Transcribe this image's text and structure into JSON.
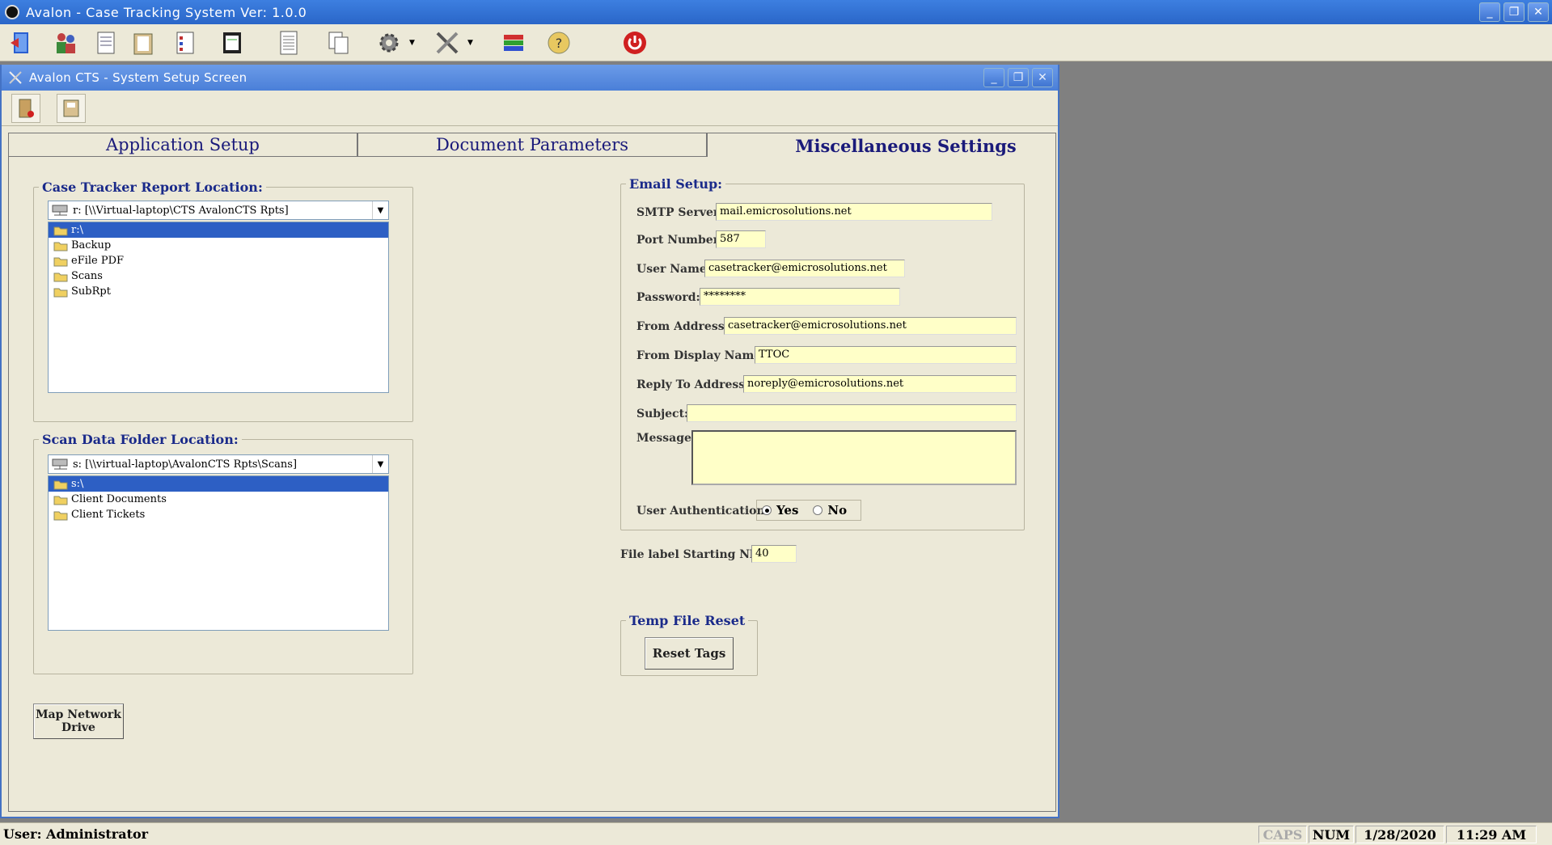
{
  "app": {
    "title": "Avalon - Case Tracking System   Ver: 1.0.0"
  },
  "window_buttons": {
    "minimize": "_",
    "restore": "❐",
    "close": "✕"
  },
  "child": {
    "title": "Avalon CTS - System Setup Screen"
  },
  "tabs": [
    {
      "label": "Application Setup"
    },
    {
      "label": "Document Parameters"
    },
    {
      "label": "Miscellaneous Settings"
    }
  ],
  "report_location": {
    "legend": "Case Tracker Report Location:",
    "drive": "r: [\\\\Virtual-laptop\\CTS AvalonCTS Rpts]",
    "folders": [
      "r:\\",
      "Backup",
      "eFile PDF",
      "Scans",
      "SubRpt"
    ]
  },
  "scan_location": {
    "legend": "Scan Data Folder Location:",
    "drive": "s: [\\\\virtual-laptop\\AvalonCTS Rpts\\Scans]",
    "folders": [
      "s:\\",
      "Client Documents",
      "Client Tickets"
    ]
  },
  "map_drive_button": {
    "line1": "Map Network",
    "line2": "Drive"
  },
  "email": {
    "legend": "Email Setup:",
    "smtp_label": "SMTP Server:",
    "smtp": "mail.emicrosolutions.net",
    "port_label": "Port Number:",
    "port": "587",
    "user_label": "User Name:",
    "user": "casetracker@emicrosolutions.net",
    "password_label": "Password:",
    "password": "********",
    "from_label": "From Address:",
    "from": "casetracker@emicrosolutions.net",
    "display_label": "From Display Name:",
    "display": "TTOC",
    "reply_label": "Reply To Address:",
    "reply": "noreply@emicrosolutions.net",
    "subject_label": "Subject:",
    "subject": "",
    "message_label": "Message:",
    "message": "",
    "auth_label": "User Authentication:",
    "yes": "Yes",
    "no": "No"
  },
  "file_label": {
    "label": "File label Starting Nbr:",
    "value": "40"
  },
  "temp_reset": {
    "legend": "Temp File Reset",
    "button": "Reset Tags"
  },
  "status": {
    "user": "User: Administrator",
    "caps": "CAPS",
    "num": "NUM",
    "date": "1/28/2020",
    "time": "11:29 AM"
  }
}
